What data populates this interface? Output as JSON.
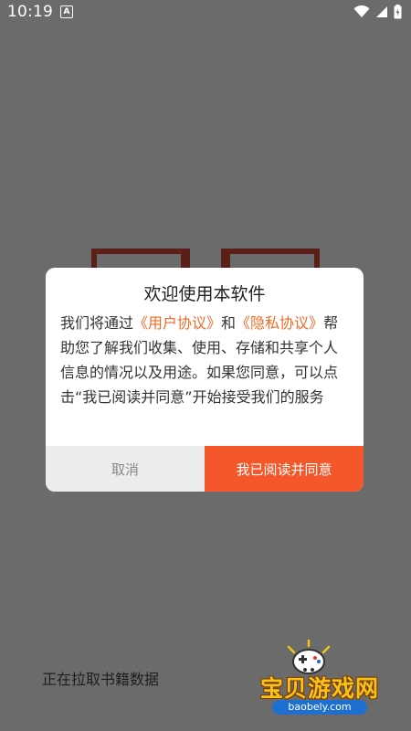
{
  "status_bar": {
    "time": "10:19",
    "notification_icon_letter": "A",
    "icons": [
      "wifi-icon",
      "signal-icon",
      "battery-charging-icon"
    ]
  },
  "dialog": {
    "title": "欢迎使用本软件",
    "body_prefix": "我们将通过",
    "user_agreement_link": "《用户协议》",
    "conjunction": "和",
    "privacy_link": "《隐私协议》",
    "body_suffix": "帮助您了解我们收集、使用、存储和共享个人信息的情况以及用途。如果您同意，可以点击“我已阅读并同意”开始接受我们的服务",
    "cancel_label": "取消",
    "agree_label": "我已阅读并同意"
  },
  "loading": {
    "text": "正在拉取书籍数据"
  },
  "watermark": {
    "brand": "宝贝游戏网",
    "url": "baobely.com"
  },
  "colors": {
    "accent": "#f4572a",
    "link": "#f06a28",
    "overlay": "#6b6b6b"
  }
}
